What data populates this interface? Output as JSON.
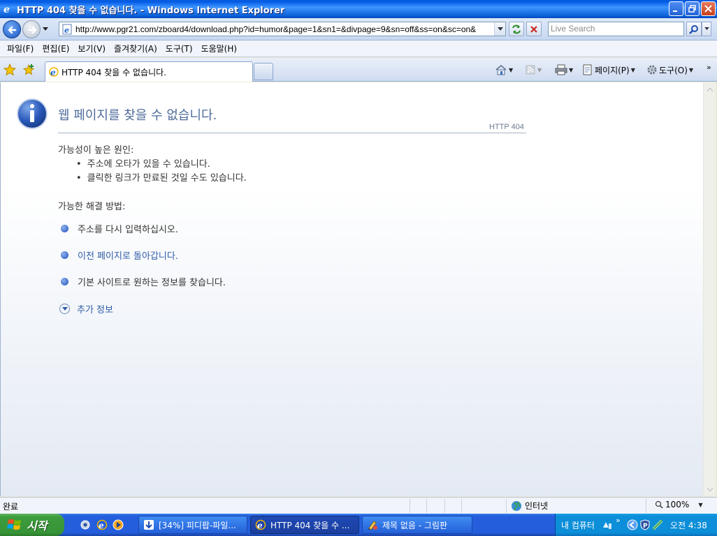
{
  "window": {
    "title": "HTTP 404 찾을 수 없습니다. - Windows Internet Explorer"
  },
  "address": {
    "url": "http://www.pgr21.com/zboard4/download.php?id=humor&page=1&sn1=&divpage=9&sn=off&ss=on&sc=on&",
    "search_placeholder": "Live Search"
  },
  "menu": {
    "items": [
      "파일(F)",
      "편집(E)",
      "보기(V)",
      "즐겨찾기(A)",
      "도구(T)",
      "도움말(H)"
    ]
  },
  "tab": {
    "title": "HTTP 404 찾을 수 없습니다."
  },
  "commands": {
    "page_label": "페이지(P)",
    "tools_label": "도구(O)"
  },
  "page": {
    "title": "웹 페이지를 찾을 수 없습니다.",
    "code": "HTTP 404",
    "cause_heading": "가능성이 높은 원인:",
    "causes": [
      "주소에 오타가 있을 수 있습니다.",
      "클릭한 링크가 만료된 것일 수도 있습니다."
    ],
    "solution_heading": "가능한 해결 방법:",
    "solutions": [
      "주소를 다시 입력하십시오.",
      "이전 페이지로 돌아갑니다.",
      "기본 사이트로  원하는 정보를 찾습니다."
    ],
    "more_info": "추가 정보"
  },
  "status": {
    "text": "완료",
    "zone": "인터넷",
    "zoom": "100%"
  },
  "taskbar": {
    "start": "시작",
    "tasks": [
      "[34%] 피디팝-파일...",
      "HTTP 404 찾을 수 ...",
      "제목 없음 - 그림판"
    ],
    "tray_label": "내 컴퓨터",
    "clock": "오전 4:38"
  },
  "colors": {
    "title_bar": "#0A5FD6",
    "taskbar": "#245EDC",
    "start_button": "#3C9C3C",
    "link": "#2F5DA8",
    "heading": "#4E6C9A"
  }
}
